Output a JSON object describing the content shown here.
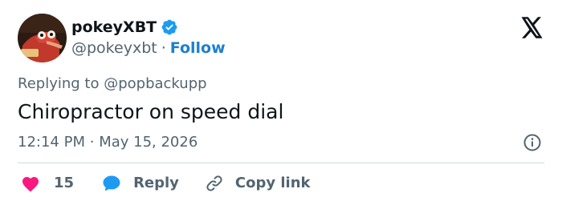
{
  "author": {
    "display_name": "pokeyXBT",
    "handle": "@pokeyxbt",
    "separator": "·",
    "follow_label": "Follow",
    "verified_color": "#1d9bf0"
  },
  "reply_context": {
    "prefix": "Replying to",
    "mention": "@popbackupp"
  },
  "tweet": {
    "text": "Chiropractor on speed dial",
    "time": "12:14 PM",
    "separator": "·",
    "date": "May 15, 2026"
  },
  "actions": {
    "like_count": "15",
    "reply_label": "Reply",
    "copy_label": "Copy link"
  },
  "colors": {
    "like": "#f91880",
    "reply": "#1d9bf0",
    "secondary_text": "#536471",
    "follow": "#1d7fcf"
  },
  "icons": {
    "brand": "x-logo-icon",
    "verified": "verified-badge-icon",
    "info": "info-icon",
    "like": "heart-icon",
    "reply": "speech-bubble-icon",
    "copy": "link-icon"
  }
}
